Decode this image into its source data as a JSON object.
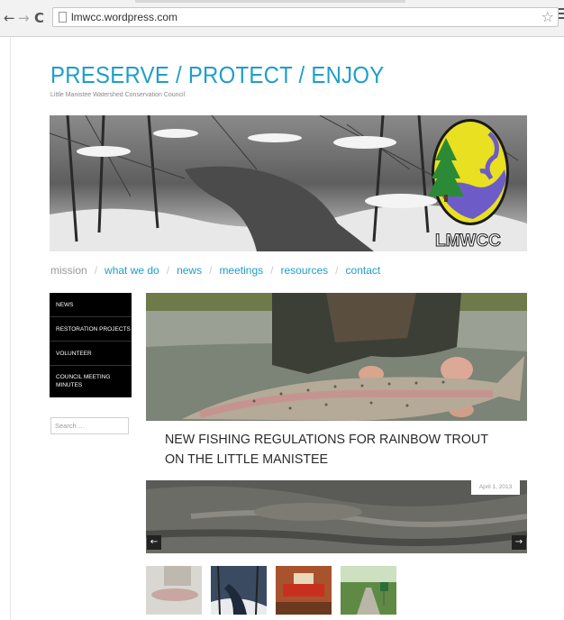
{
  "browser": {
    "url": "lmwcc.wordpress.com"
  },
  "site": {
    "title": "PRESERVE / PROTECT / ENJOY",
    "tagline": "Little Manistee Watershed Conservation Council",
    "logo_text": "LMWCC"
  },
  "nav": {
    "items": [
      "mission",
      "what we do",
      "news",
      "meetings",
      "resources",
      "contact"
    ],
    "separator": "/"
  },
  "sidebar": {
    "menu": [
      "NEWS",
      "RESTORATION PROJECTS",
      "VOLUNTEER",
      "COUNCIL MEETING MINUTES"
    ],
    "search_placeholder": "Search …"
  },
  "featured_post": {
    "title": "NEW FISHING REGULATIONS FOR RAINBOW TROUT ON THE LITTLE MANISTEE"
  },
  "slider": {
    "date": "April 1, 2013",
    "prev": "←",
    "next": "→"
  },
  "colors": {
    "accent": "#1e9ec9",
    "sidebar_bg": "#000000"
  }
}
